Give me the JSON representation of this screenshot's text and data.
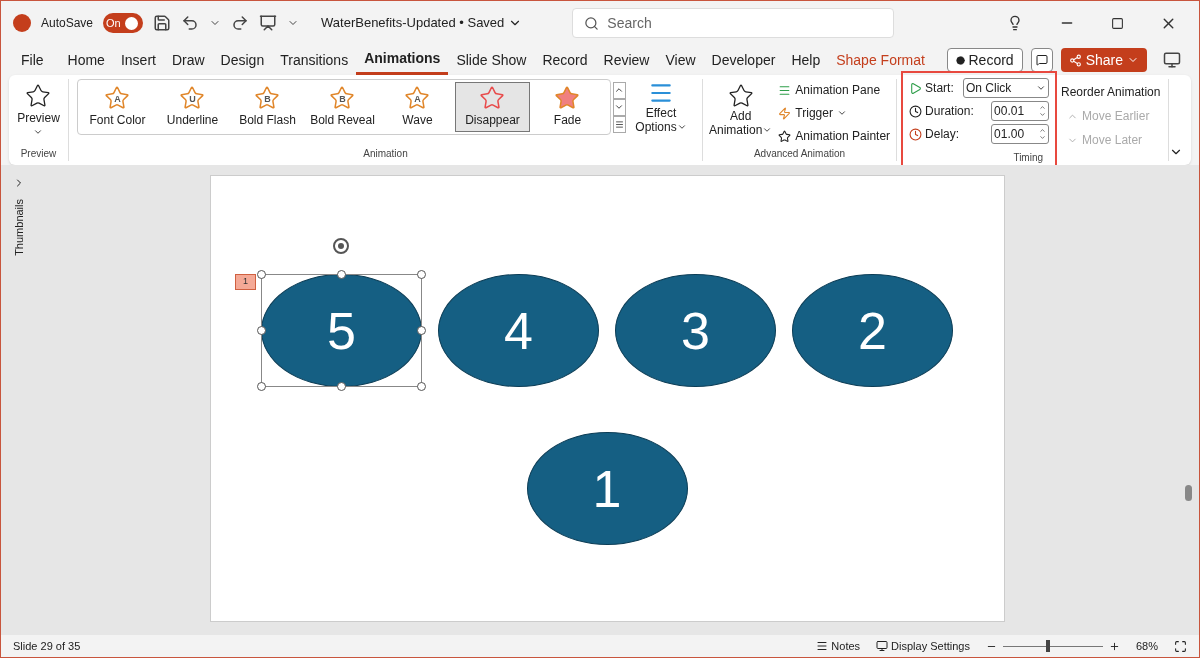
{
  "title_bar": {
    "autosave_label": "AutoSave",
    "autosave": {
      "label": "On",
      "on": true
    },
    "document": "WaterBenefits-Updated • Saved",
    "search": {
      "placeholder": "Search"
    }
  },
  "tabs": [
    {
      "label": "File",
      "selected": false,
      "kind": "normal"
    },
    {
      "label": "Home",
      "selected": false,
      "kind": "normal"
    },
    {
      "label": "Insert",
      "selected": false,
      "kind": "normal"
    },
    {
      "label": "Draw",
      "selected": false,
      "kind": "normal"
    },
    {
      "label": "Design",
      "selected": false,
      "kind": "normal"
    },
    {
      "label": "Transitions",
      "selected": false,
      "kind": "normal"
    },
    {
      "label": "Animations",
      "selected": true,
      "kind": "normal"
    },
    {
      "label": "Slide Show",
      "selected": false,
      "kind": "normal"
    },
    {
      "label": "Record",
      "selected": false,
      "kind": "normal"
    },
    {
      "label": "Review",
      "selected": false,
      "kind": "normal"
    },
    {
      "label": "View",
      "selected": false,
      "kind": "normal"
    },
    {
      "label": "Developer",
      "selected": false,
      "kind": "normal"
    },
    {
      "label": "Help",
      "selected": false,
      "kind": "normal"
    },
    {
      "label": "Shape Format",
      "selected": false,
      "kind": "contextual"
    }
  ],
  "tab_actions": {
    "record": "Record",
    "share": "Share"
  },
  "ribbon": {
    "preview": {
      "button": "Preview",
      "group": "Preview"
    },
    "animation": {
      "group": "Animation",
      "effects": [
        {
          "label": "Font Color",
          "letter": "A",
          "selected": false
        },
        {
          "label": "Underline",
          "letter": "U",
          "selected": false
        },
        {
          "label": "Bold Flash",
          "letter": "B",
          "selected": false
        },
        {
          "label": "Bold Reveal",
          "letter": "B",
          "selected": false
        },
        {
          "label": "Wave",
          "letter": "A",
          "selected": false
        },
        {
          "label": "Disappear",
          "selected": true
        },
        {
          "label": "Fade",
          "selected": false
        }
      ],
      "effect_options": [
        "Effect",
        "Options"
      ]
    },
    "advanced": {
      "group": "Advanced Animation",
      "add_animation": [
        "Add",
        "Animation"
      ],
      "animation_pane": "Animation Pane",
      "trigger": "Trigger",
      "animation_painter": "Animation Painter"
    },
    "timing": {
      "group": "Timing",
      "start_label": "Start:",
      "start": "On Click",
      "duration_label": "Duration:",
      "duration": "00.01",
      "delay_label": "Delay:",
      "delay": "01.00"
    },
    "reorder": {
      "title": "Reorder Animation",
      "items": [
        {
          "label": "Move Earlier",
          "disabled": true
        },
        {
          "label": "Move Later",
          "disabled": true
        }
      ]
    }
  },
  "sidebar": {
    "label": "Thumbnails"
  },
  "slide": {
    "animation_tag": "1",
    "shapes": [
      {
        "label": "5",
        "selected": true
      },
      {
        "label": "4",
        "selected": false
      },
      {
        "label": "3",
        "selected": false
      },
      {
        "label": "2",
        "selected": false
      },
      {
        "label": "1",
        "selected": false
      }
    ]
  },
  "status_bar": {
    "slide": "Slide 29 of 35",
    "notes": "Notes",
    "display_settings": "Display Settings",
    "zoom": {
      "level": 0.45,
      "reading": "68%"
    }
  }
}
